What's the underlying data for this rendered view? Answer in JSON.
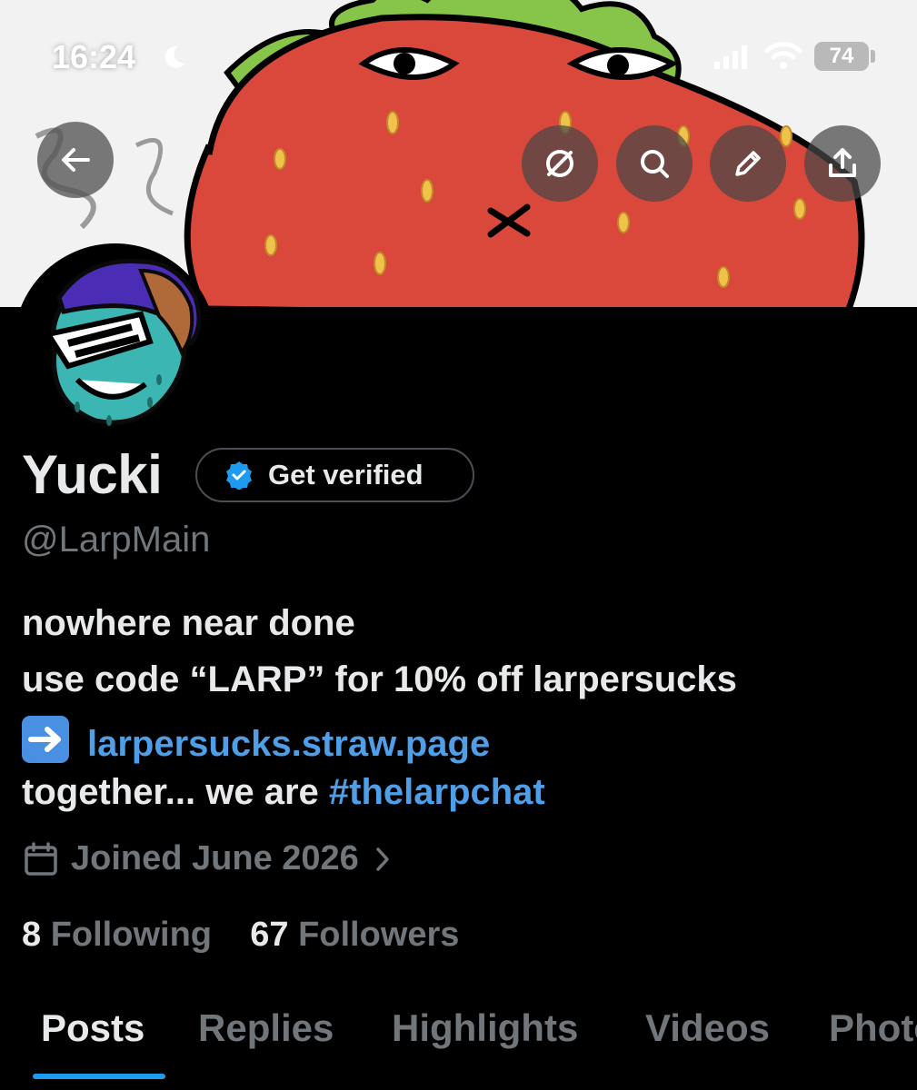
{
  "status_bar": {
    "time": "16:24",
    "battery": "74"
  },
  "header": {
    "back_icon": "arrow-left-icon",
    "actions": [
      "grok-icon",
      "search-icon",
      "pencil-icon",
      "share-icon"
    ]
  },
  "profile": {
    "name": "Yucki",
    "verify_label": "Get verified",
    "handle": "@LarpMain",
    "bio": {
      "line1": "nowhere near done",
      "line2": "use code “LARP” for 10% off larpersucks",
      "line3_link": "larpersucks.straw.page",
      "line4_prefix": "together... we are ",
      "line4_hashtag": "#thelarpchat"
    },
    "joined": "Joined June 2026",
    "following_count": "8",
    "following_label": "Following",
    "followers_count": "67",
    "followers_label": "Followers"
  },
  "tabs": [
    "Posts",
    "Replies",
    "Highlights",
    "Videos",
    "Photos"
  ],
  "colors": {
    "accent": "#1d9bf0",
    "link": "#4e9ee8",
    "muted": "#71767b",
    "text": "#e7e9ea",
    "banner_strawberry": "#d9483b"
  }
}
